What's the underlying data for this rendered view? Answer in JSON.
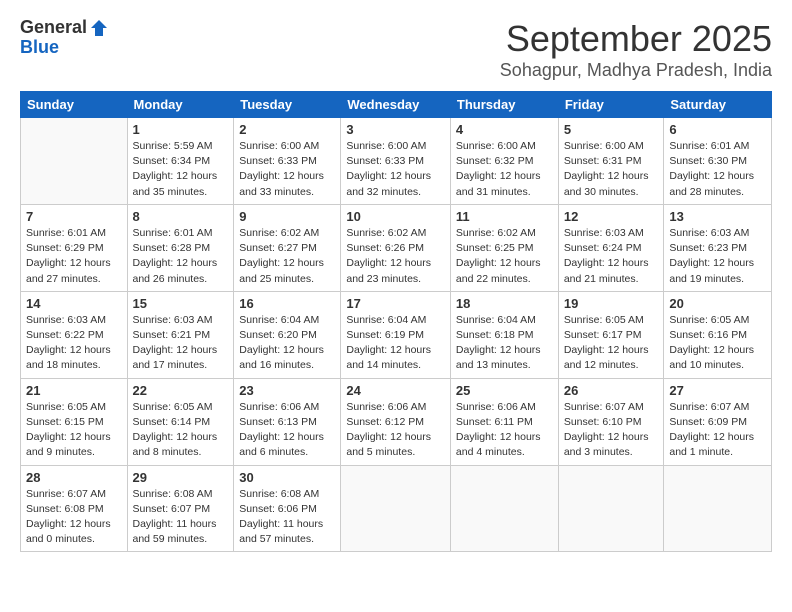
{
  "header": {
    "logo_general": "General",
    "logo_blue": "Blue",
    "month_title": "September 2025",
    "location": "Sohagpur, Madhya Pradesh, India"
  },
  "weekdays": [
    "Sunday",
    "Monday",
    "Tuesday",
    "Wednesday",
    "Thursday",
    "Friday",
    "Saturday"
  ],
  "weeks": [
    [
      {
        "day": "",
        "info": ""
      },
      {
        "day": "1",
        "info": "Sunrise: 5:59 AM\nSunset: 6:34 PM\nDaylight: 12 hours\nand 35 minutes."
      },
      {
        "day": "2",
        "info": "Sunrise: 6:00 AM\nSunset: 6:33 PM\nDaylight: 12 hours\nand 33 minutes."
      },
      {
        "day": "3",
        "info": "Sunrise: 6:00 AM\nSunset: 6:33 PM\nDaylight: 12 hours\nand 32 minutes."
      },
      {
        "day": "4",
        "info": "Sunrise: 6:00 AM\nSunset: 6:32 PM\nDaylight: 12 hours\nand 31 minutes."
      },
      {
        "day": "5",
        "info": "Sunrise: 6:00 AM\nSunset: 6:31 PM\nDaylight: 12 hours\nand 30 minutes."
      },
      {
        "day": "6",
        "info": "Sunrise: 6:01 AM\nSunset: 6:30 PM\nDaylight: 12 hours\nand 28 minutes."
      }
    ],
    [
      {
        "day": "7",
        "info": "Sunrise: 6:01 AM\nSunset: 6:29 PM\nDaylight: 12 hours\nand 27 minutes."
      },
      {
        "day": "8",
        "info": "Sunrise: 6:01 AM\nSunset: 6:28 PM\nDaylight: 12 hours\nand 26 minutes."
      },
      {
        "day": "9",
        "info": "Sunrise: 6:02 AM\nSunset: 6:27 PM\nDaylight: 12 hours\nand 25 minutes."
      },
      {
        "day": "10",
        "info": "Sunrise: 6:02 AM\nSunset: 6:26 PM\nDaylight: 12 hours\nand 23 minutes."
      },
      {
        "day": "11",
        "info": "Sunrise: 6:02 AM\nSunset: 6:25 PM\nDaylight: 12 hours\nand 22 minutes."
      },
      {
        "day": "12",
        "info": "Sunrise: 6:03 AM\nSunset: 6:24 PM\nDaylight: 12 hours\nand 21 minutes."
      },
      {
        "day": "13",
        "info": "Sunrise: 6:03 AM\nSunset: 6:23 PM\nDaylight: 12 hours\nand 19 minutes."
      }
    ],
    [
      {
        "day": "14",
        "info": "Sunrise: 6:03 AM\nSunset: 6:22 PM\nDaylight: 12 hours\nand 18 minutes."
      },
      {
        "day": "15",
        "info": "Sunrise: 6:03 AM\nSunset: 6:21 PM\nDaylight: 12 hours\nand 17 minutes."
      },
      {
        "day": "16",
        "info": "Sunrise: 6:04 AM\nSunset: 6:20 PM\nDaylight: 12 hours\nand 16 minutes."
      },
      {
        "day": "17",
        "info": "Sunrise: 6:04 AM\nSunset: 6:19 PM\nDaylight: 12 hours\nand 14 minutes."
      },
      {
        "day": "18",
        "info": "Sunrise: 6:04 AM\nSunset: 6:18 PM\nDaylight: 12 hours\nand 13 minutes."
      },
      {
        "day": "19",
        "info": "Sunrise: 6:05 AM\nSunset: 6:17 PM\nDaylight: 12 hours\nand 12 minutes."
      },
      {
        "day": "20",
        "info": "Sunrise: 6:05 AM\nSunset: 6:16 PM\nDaylight: 12 hours\nand 10 minutes."
      }
    ],
    [
      {
        "day": "21",
        "info": "Sunrise: 6:05 AM\nSunset: 6:15 PM\nDaylight: 12 hours\nand 9 minutes."
      },
      {
        "day": "22",
        "info": "Sunrise: 6:05 AM\nSunset: 6:14 PM\nDaylight: 12 hours\nand 8 minutes."
      },
      {
        "day": "23",
        "info": "Sunrise: 6:06 AM\nSunset: 6:13 PM\nDaylight: 12 hours\nand 6 minutes."
      },
      {
        "day": "24",
        "info": "Sunrise: 6:06 AM\nSunset: 6:12 PM\nDaylight: 12 hours\nand 5 minutes."
      },
      {
        "day": "25",
        "info": "Sunrise: 6:06 AM\nSunset: 6:11 PM\nDaylight: 12 hours\nand 4 minutes."
      },
      {
        "day": "26",
        "info": "Sunrise: 6:07 AM\nSunset: 6:10 PM\nDaylight: 12 hours\nand 3 minutes."
      },
      {
        "day": "27",
        "info": "Sunrise: 6:07 AM\nSunset: 6:09 PM\nDaylight: 12 hours\nand 1 minute."
      }
    ],
    [
      {
        "day": "28",
        "info": "Sunrise: 6:07 AM\nSunset: 6:08 PM\nDaylight: 12 hours\nand 0 minutes."
      },
      {
        "day": "29",
        "info": "Sunrise: 6:08 AM\nSunset: 6:07 PM\nDaylight: 11 hours\nand 59 minutes."
      },
      {
        "day": "30",
        "info": "Sunrise: 6:08 AM\nSunset: 6:06 PM\nDaylight: 11 hours\nand 57 minutes."
      },
      {
        "day": "",
        "info": ""
      },
      {
        "day": "",
        "info": ""
      },
      {
        "day": "",
        "info": ""
      },
      {
        "day": "",
        "info": ""
      }
    ]
  ]
}
